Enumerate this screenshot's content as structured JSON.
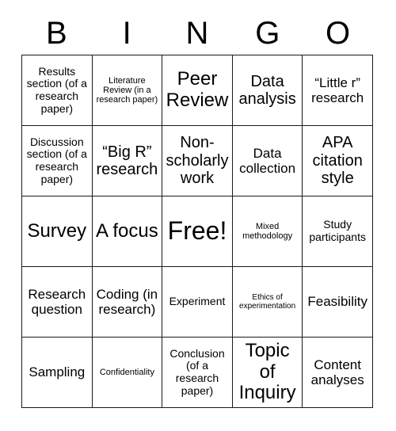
{
  "header": {
    "letters": [
      "B",
      "I",
      "N",
      "G",
      "O"
    ]
  },
  "grid": {
    "rows": 5,
    "columns": 5,
    "border_color": "#1a1a1a",
    "cell_background": "#ffffff",
    "text_color": "#000000",
    "cells": [
      {
        "text": "Results section (of a research paper)",
        "size": "sm"
      },
      {
        "text": "Literature Review (in a research paper)",
        "size": "xs"
      },
      {
        "text": "Peer Review",
        "size": "xl"
      },
      {
        "text": "Data analysis",
        "size": "lg"
      },
      {
        "text": "“Little r” research",
        "size": "md"
      },
      {
        "text": "Discussion section (of a research paper)",
        "size": "sm"
      },
      {
        "text": "“Big R” research",
        "size": "lg"
      },
      {
        "text": "Non-scholarly work",
        "size": "lg"
      },
      {
        "text": "Data collection",
        "size": "md"
      },
      {
        "text": "APA citation style",
        "size": "lg"
      },
      {
        "text": "Survey",
        "size": "xl"
      },
      {
        "text": "A focus",
        "size": "xl"
      },
      {
        "text": "Free!",
        "size": "xxl"
      },
      {
        "text": "Mixed methodology",
        "size": "xs"
      },
      {
        "text": "Study participants",
        "size": "sm"
      },
      {
        "text": "Research question",
        "size": "md"
      },
      {
        "text": "Coding (in research)",
        "size": "md"
      },
      {
        "text": "Experiment",
        "size": "sm"
      },
      {
        "text": "Ethics of experimentation",
        "size": "xxs"
      },
      {
        "text": "Feasibility",
        "size": "md"
      },
      {
        "text": "Sampling",
        "size": "md"
      },
      {
        "text": "Confidentiality",
        "size": "xs"
      },
      {
        "text": "Conclusion (of a research paper)",
        "size": "sm"
      },
      {
        "text": "Topic of Inquiry",
        "size": "xl"
      },
      {
        "text": "Content analyses",
        "size": "md"
      }
    ]
  }
}
